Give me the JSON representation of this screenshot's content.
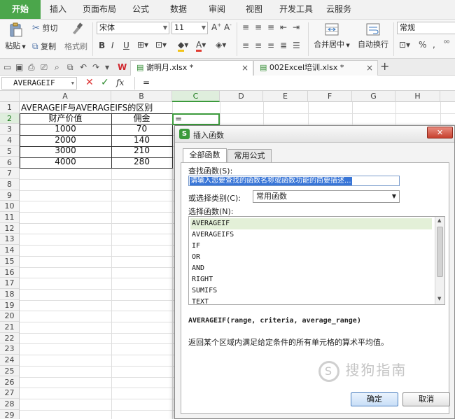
{
  "menu_tabs": [
    "开始",
    "插入",
    "页面布局",
    "公式",
    "数据",
    "审阅",
    "视图",
    "开发工具",
    "云服务"
  ],
  "ribbon": {
    "paste": "粘贴",
    "cut": "剪切",
    "copy": "复制",
    "format_painter": "格式刷",
    "font_name": "宋体",
    "font_size": "11",
    "merge_center": "合并居中",
    "wrap_text": "自动换行",
    "number_format": "常规",
    "percent_symbol": "%"
  },
  "doc_tabs": [
    {
      "name": "谢明月.xlsx *",
      "active": true
    },
    {
      "name": "002Excel培训.xlsx *",
      "active": false
    }
  ],
  "doc_new_tab": "+",
  "formula_bar": {
    "name_box": "AVERAGEIF",
    "fx": "fx",
    "content": "="
  },
  "columns": [
    "A",
    "B",
    "C",
    "D",
    "E",
    "F",
    "G",
    "H"
  ],
  "rows": [
    "1",
    "2",
    "3",
    "4",
    "5",
    "6",
    "7",
    "8",
    "9",
    "10",
    "11",
    "12",
    "13",
    "14",
    "15",
    "16",
    "17",
    "18",
    "19",
    "20",
    "21",
    "22",
    "23",
    "24",
    "25",
    "26",
    "27",
    "28",
    "29"
  ],
  "sheet": {
    "title": "AVERAGEIF与AVERAGEIFS的区别",
    "header_a": "财产价值",
    "header_b": "佣金",
    "active_cell_value": "=",
    "data": [
      {
        "a": "1000",
        "b": "70"
      },
      {
        "a": "2000",
        "b": "140"
      },
      {
        "a": "3000",
        "b": "210"
      },
      {
        "a": "4000",
        "b": "280"
      }
    ]
  },
  "dialog": {
    "title": "插入函数",
    "tab_all": "全部函数",
    "tab_common": "常用公式",
    "search_label": "查找函数(S):",
    "search_placeholder": "请输入您要查找的函数名称或函数功能的简要描述...",
    "category_label": "或选择类别(C):",
    "category_value": "常用函数",
    "select_label": "选择函数(N):",
    "functions": [
      "AVERAGEIF",
      "AVERAGEIFS",
      "IF",
      "OR",
      "AND",
      "RIGHT",
      "SUMIFS",
      "TEXT"
    ],
    "signature": "AVERAGEIF(range, criteria, average_range)",
    "description": "返回某个区域内满足给定条件的所有单元格的算术平均值。",
    "ok": "确定",
    "cancel": "取消"
  },
  "watermark": "搜狗指南",
  "colors": {
    "accent_green": "#4ba64b",
    "selection_blue": "#3875d7",
    "list_selection": "#e3f0d8"
  }
}
